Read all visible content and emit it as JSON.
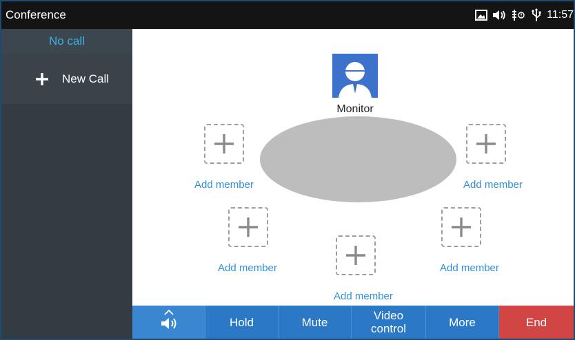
{
  "status_bar": {
    "title": "Conference",
    "time": "11:57",
    "icons": [
      "image-icon",
      "volume-icon",
      "network-icon",
      "usb-icon"
    ]
  },
  "sidebar": {
    "status": "No call",
    "new_call_label": "New Call"
  },
  "main": {
    "monitor_label": "Monitor",
    "add_member_label": "Add member"
  },
  "bottom_bar": {
    "hold": "Hold",
    "mute": "Mute",
    "video_line1": "Video",
    "video_line2": "control",
    "more": "More",
    "end": "End"
  },
  "colors": {
    "accent_blue": "#2a78c6",
    "end_red": "#d24545",
    "avatar_blue": "#3d72cc",
    "link_blue": "#2e8fd8"
  }
}
